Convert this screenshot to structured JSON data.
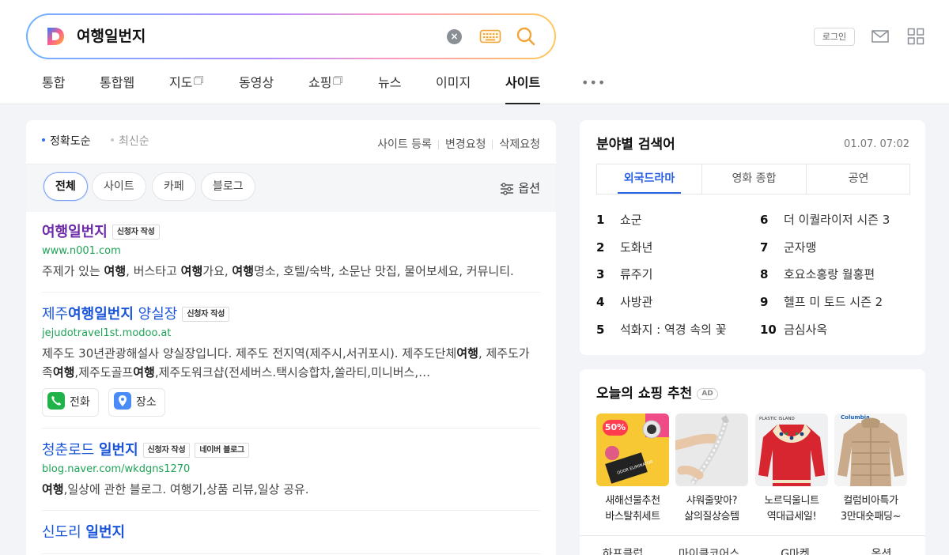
{
  "search": {
    "query": "여행일번지"
  },
  "header": {
    "login_label": "로그인"
  },
  "tabs": [
    {
      "label": "통합",
      "ext": false
    },
    {
      "label": "통합웹",
      "ext": false
    },
    {
      "label": "지도",
      "ext": true
    },
    {
      "label": "동영상",
      "ext": false
    },
    {
      "label": "쇼핑",
      "ext": true
    },
    {
      "label": "뉴스",
      "ext": false
    },
    {
      "label": "이미지",
      "ext": false
    },
    {
      "label": "사이트",
      "ext": false,
      "active": true
    }
  ],
  "more_label": "•••",
  "sort": {
    "accuracy": "정확도순",
    "latest": "최신순"
  },
  "site_links": [
    "사이트 등록",
    "변경요청",
    "삭제요청"
  ],
  "filters": [
    "전체",
    "사이트",
    "카페",
    "블로그"
  ],
  "options_label": "옵션",
  "results": [
    {
      "title_pre": "",
      "title_bold": "여행일번지",
      "title_post": "",
      "badges": [
        "신청자 작성"
      ],
      "url": "www.n001.com",
      "desc_html": "주제가 있는 <b>여행</b>, 버스타고 <b>여행</b>가요, <b>여행</b>명소, 호텔/숙박, 소문난 맛집, 물어보세요, 커뮤니티."
    },
    {
      "title_pre": "제주",
      "title_bold": "여행일번지",
      "title_post": " 양실장",
      "badges": [
        "신청자 작성"
      ],
      "url": "jejudotravel1st.modoo.at",
      "desc_html": "제주도 30년관광해설사 양실장입니다. 제주도 전지역(제주시,서귀포시). 제주도단체<b>여행</b>, 제주도가족<b>여행</b>,제주도골프<b>여행</b>,제주도워크샵(전세버스.택시승합차,쏠라티,미니버스,…",
      "buttons": [
        "전화",
        "장소"
      ]
    },
    {
      "title_pre": "청춘로드 ",
      "title_bold": "일번지",
      "title_post": "",
      "badges": [
        "신청자 작성",
        "네이버 블로그"
      ],
      "url": "blog.naver.com/wkdgns1270",
      "desc_html": "<b>여행</b>,일상에 관한 블로그. 여행기,상품 리뷰,일상 공유."
    },
    {
      "title_pre": "신도리 ",
      "title_bold": "일번지",
      "title_post": ""
    }
  ],
  "keywords": {
    "title": "분야별 검색어",
    "time": "01.07. 07:02",
    "tabs": [
      "외국드라마",
      "영화 종합",
      "공연"
    ],
    "items": [
      {
        "rank": "1",
        "label": "쇼군"
      },
      {
        "rank": "2",
        "label": "도화년"
      },
      {
        "rank": "3",
        "label": "류주기"
      },
      {
        "rank": "4",
        "label": "사방관"
      },
      {
        "rank": "5",
        "label": "석화지 : 역경 속의 꽃"
      },
      {
        "rank": "6",
        "label": "더 이퀄라이저 시즌 3"
      },
      {
        "rank": "7",
        "label": "군자맹"
      },
      {
        "rank": "8",
        "label": "호요소홍랑 월홍편"
      },
      {
        "rank": "9",
        "label": "헬프 미 토드 시즌 2"
      },
      {
        "rank": "10",
        "label": "금심사옥"
      }
    ]
  },
  "shopping": {
    "title": "오늘의 쇼핑 추천",
    "ad_label": "AD",
    "sale_label": "50%",
    "products": [
      {
        "line1": "새해선물추천",
        "line2": "바스탈취세트"
      },
      {
        "line1": "샤워줄맞아?",
        "line2": "삶의질상승템"
      },
      {
        "line1": "노르딕울니트",
        "line2": "역대급세일!"
      },
      {
        "line1": "컬럼비아특가",
        "line2": "3만대숏패딩~"
      }
    ],
    "product_brand_plastic": "PLASTIC ISLAND",
    "product_brand_columbia": "Columbia",
    "product_box_text": "ODOR ELIMINATOR",
    "malls": [
      "하프클럽",
      "마이클코어스",
      "G마켓",
      "옥션"
    ]
  }
}
